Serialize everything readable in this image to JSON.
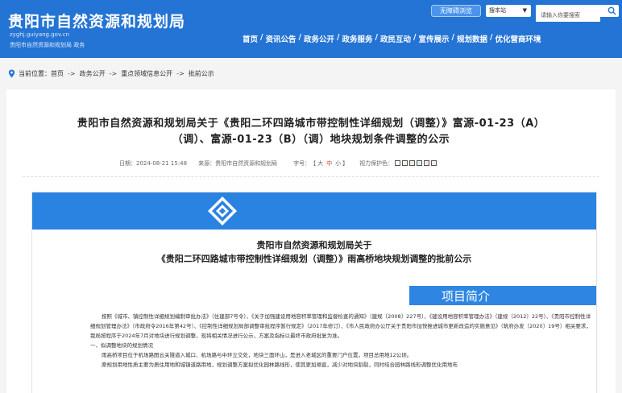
{
  "header": {
    "title": "贵阳市自然资源和规划局",
    "domain": "zyghj.guiyang.gov.cn",
    "subtitle": "贵阳市自然资源和规划局 政务",
    "barrier_free": "无障碍浏览",
    "search_scope": "搜本站",
    "search_placeholder": "请输入你要搜索",
    "nav": [
      "首页",
      "资讯公告",
      "政务公开",
      "政务服务",
      "政民互动",
      "宣传展示",
      "规划数据",
      "优化营商环境"
    ],
    "nav_separator": "/"
  },
  "breadcrumb": {
    "prefix": "当前位置：",
    "items": [
      "首页",
      "政务公开",
      "重点领域信息公开",
      "批前公示"
    ],
    "arrow": "->"
  },
  "article": {
    "title_line1": "贵阳市自然资源和规划局关于《贵阳二环四路城市带控制性详细规划（调整）》富源-01-23（A）",
    "title_line2": "（调）、富源-01-23（B）（调）地块规划条件调整的公示",
    "date_label": "日期：",
    "date": "2024-08-21 15:48",
    "source_label": "来源：",
    "source": "贵阳市自然资源和规划局",
    "fontsize_label": "字号：",
    "font_large": "大",
    "font_medium": "中",
    "font_small": "小",
    "bracket_open": "【",
    "bracket_close": "】",
    "vision_label": "视力保护色：",
    "vision_colors": [
      "#ffffff",
      "#f5f5dc",
      "#e6f2e0",
      "#e0ecf5",
      "#f5e6e8",
      "#eeeeee"
    ]
  },
  "notice": {
    "title_line1": "贵阳市自然资源和规划局关于",
    "title_line2": "《贵阳二环四路城市带控制性详细规划（调整）》雨高桥地块规划调整的批前公示",
    "section_label": "项目简介",
    "para1": "按照《城市、镇控制性详细规划编制审批办法》（住建部7号令）、《关于加强建设用地容积率管理和监督检查的通知》（建规〔2008〕227号）、《建设用地容积率管理办法》（建规〔2012〕22号）、《贵阳市控制性详细规划管理办法》（市政府令2016年第42号）、《控制性详细规划局部调整审批程序暂行规定》（2017年修订）、《市人民政府办公厅关于贵阳市加快推进城市更新改造的实施意见》（筑府办发〔2020〕19号）相关要求，我局按程序于2024年7月对地块进行规划调整，现将相关情况进行公示，方案及指标以最终市政府批复为准。",
    "heading1": "一、拟调整地块的规划情况",
    "para2": "雨高桥项目位于机场路图云关隧道入城口、机场路与中环立交处，地块三面环山，是进入老城区的重要门户位置，项目总用地12公顷。",
    "para3": "原规划用地性质主要为居住用地和城镇道路用地，规划调整方案拟优化园林路线形，使其更加顺直，减少对地块割裂，同时结合园林路线形调整优化用地布"
  },
  "colors": {
    "header_blue": "#2374d4",
    "accent_blue": "#2a83e0",
    "red": "#c0392b"
  }
}
